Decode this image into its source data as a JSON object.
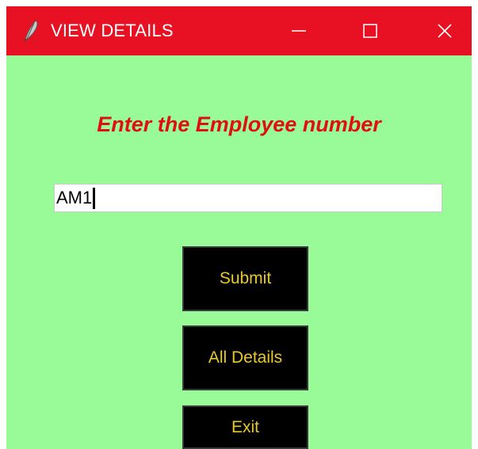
{
  "window": {
    "title": "VIEW DETAILS",
    "icon": "feather-icon",
    "controls": [
      "minimize-icon",
      "maximize-icon",
      "close-icon"
    ],
    "title_bar_color": "#e81123",
    "background_color": "#98fb98"
  },
  "form": {
    "heading": "Enter the Employee number",
    "heading_color": "#e01010",
    "employee_number_value": "AM1"
  },
  "buttons": {
    "submit_label": "Submit",
    "all_details_label": "All Details",
    "exit_label": "Exit",
    "background_color": "#000000",
    "text_color": "#e8c830"
  }
}
